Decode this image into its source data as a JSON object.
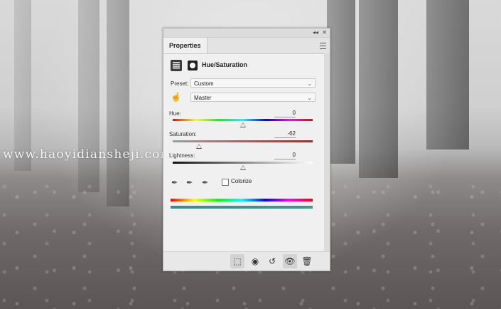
{
  "watermark": "www.haoyidiansheji.com",
  "panel": {
    "tab_title": "Properties",
    "collapse_glyph": "◂◂",
    "close_glyph": "✕",
    "header": {
      "title": "Hue/Saturation",
      "adjustment_icon": "hue-saturation-adjustment-icon",
      "mask_icon": "layer-mask-icon"
    },
    "preset": {
      "label": "Preset:",
      "value": "Custom"
    },
    "channel": {
      "value": "Master"
    },
    "hue": {
      "label": "Hue:",
      "value": "0",
      "level": 0.5
    },
    "saturation": {
      "label": "Saturation:",
      "value": "-62",
      "level": 0.19
    },
    "lightness": {
      "label": "Lightness:",
      "value": "0",
      "level": 0.5
    },
    "colorize": {
      "label": "Colorize",
      "checked": false
    },
    "droppers": [
      "eyedropper-icon",
      "eyedropper-plus-icon",
      "eyedropper-minus-icon"
    ],
    "footer_icons": [
      "clip-to-layer-icon",
      "view-previous-state-icon",
      "reset-icon",
      "visibility-eye-icon",
      "trash-icon"
    ]
  }
}
